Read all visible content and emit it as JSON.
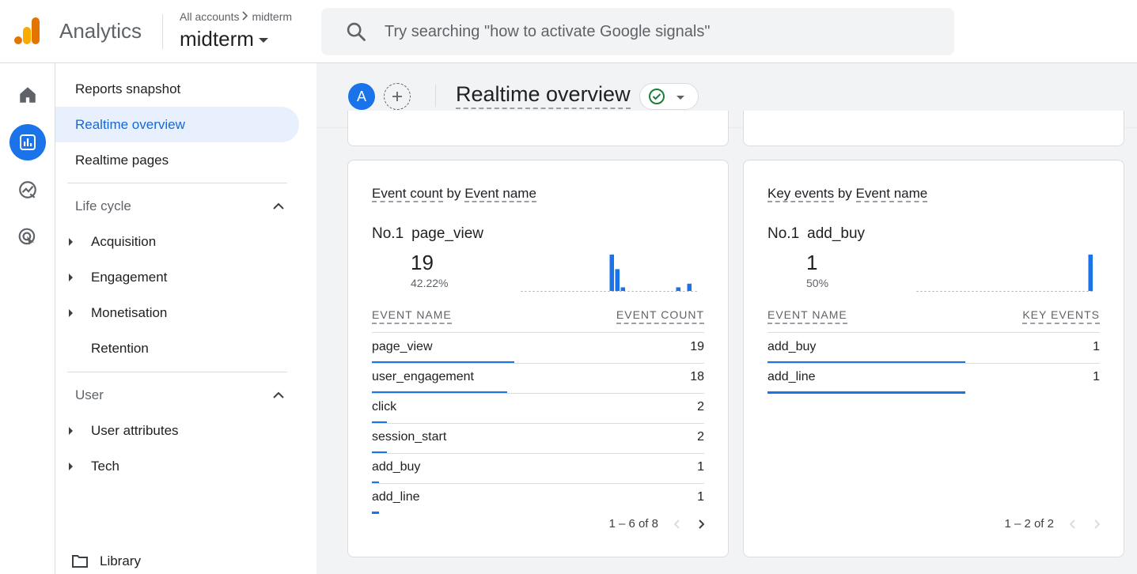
{
  "topbar": {
    "app_name": "Analytics",
    "breadcrumb_all": "All accounts",
    "breadcrumb_account": "midterm",
    "property_name": "midterm",
    "search_placeholder": "Try searching \"how to activate Google signals\""
  },
  "rail": {
    "items": [
      "home-icon",
      "reports-icon",
      "explore-icon",
      "advertising-icon"
    ]
  },
  "sidebar": {
    "top_items": [
      {
        "label": "Reports snapshot"
      },
      {
        "label": "Realtime overview"
      },
      {
        "label": "Realtime pages"
      }
    ],
    "lifecycle": {
      "title": "Life cycle",
      "items": [
        {
          "label": "Acquisition"
        },
        {
          "label": "Engagement"
        },
        {
          "label": "Monetisation"
        },
        {
          "label": "Retention"
        }
      ]
    },
    "user": {
      "title": "User",
      "items": [
        {
          "label": "User attributes"
        },
        {
          "label": "Tech"
        }
      ]
    },
    "library": "Library"
  },
  "header": {
    "avatar_letter": "A",
    "title": "Realtime overview"
  },
  "cards": {
    "events": {
      "title_part1": "Event count",
      "title_by": " by ",
      "title_part2": "Event name",
      "rank": "No.1",
      "top_name": "page_view",
      "top_value": "19",
      "top_pct": "42.22%",
      "col_name": "EVENT NAME",
      "col_value": "EVENT COUNT",
      "rows": [
        {
          "name": "page_view",
          "value": "19",
          "share": 0.42
        },
        {
          "name": "user_engagement",
          "value": "18",
          "share": 0.4
        },
        {
          "name": "click",
          "value": "2",
          "share": 0.044
        },
        {
          "name": "session_start",
          "value": "2",
          "share": 0.044
        },
        {
          "name": "add_buy",
          "value": "1",
          "share": 0.022
        },
        {
          "name": "add_line",
          "value": "1",
          "share": 0.022
        }
      ],
      "pager": "1 – 6 of 8",
      "spark": [
        0,
        0,
        0,
        0,
        0,
        0,
        0,
        0,
        0,
        0,
        0,
        0,
        0,
        0,
        0,
        0,
        10,
        6,
        1,
        0,
        0,
        0,
        0,
        0,
        0,
        0,
        0,
        0,
        1,
        0,
        2,
        0
      ]
    },
    "key_events": {
      "title_part1": "Key events",
      "title_by": " by ",
      "title_part2": "Event name",
      "rank": "No.1",
      "top_name": "add_buy",
      "top_value": "1",
      "top_pct": "50%",
      "col_name": "EVENT NAME",
      "col_value": "KEY EVENTS",
      "rows": [
        {
          "name": "add_buy",
          "value": "1",
          "share": 0.5
        },
        {
          "name": "add_line",
          "value": "1",
          "share": 0.5
        }
      ],
      "pager": "1 – 2 of 2",
      "spark": [
        0,
        0,
        0,
        0,
        0,
        0,
        0,
        0,
        0,
        0,
        0,
        0,
        0,
        0,
        0,
        0,
        0,
        0,
        0,
        0,
        0,
        0,
        0,
        0,
        0,
        0,
        0,
        0,
        0,
        0,
        0,
        1
      ]
    }
  },
  "colors": {
    "accent": "#1a73e8",
    "active_bg": "#e8f0fe",
    "status_ok": "#188038"
  }
}
